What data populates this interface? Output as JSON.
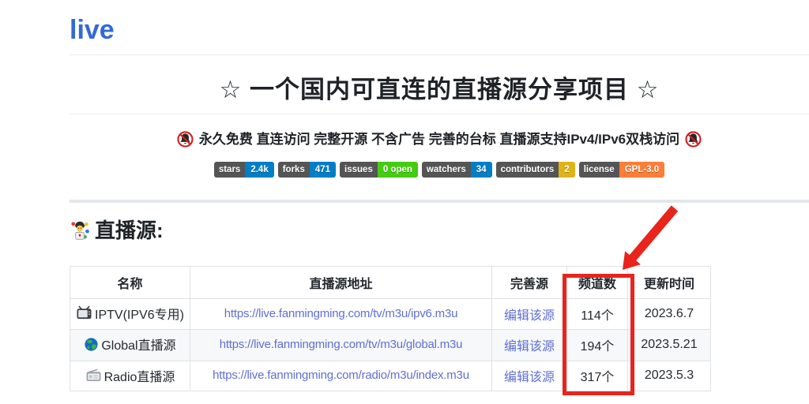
{
  "page": {
    "title": "live",
    "hero_title": "☆ 一个国内可直连的直播源分享项目 ☆",
    "subtitle": "永久免费 直连访问 完整开源 不含广告 完善的台标 直播源支持IPv4/IPv6双栈访问",
    "section_heading": "直播源:"
  },
  "badges": [
    {
      "label": "stars",
      "value": "2.4k",
      "color": "#007ec6"
    },
    {
      "label": "forks",
      "value": "471",
      "color": "#007ec6"
    },
    {
      "label": "issues",
      "value": "0 open",
      "color": "#44cc11"
    },
    {
      "label": "watchers",
      "value": "34",
      "color": "#007ec6"
    },
    {
      "label": "contributors",
      "value": "2",
      "color": "#dfb317"
    },
    {
      "label": "license",
      "value": "GPL-3.0",
      "color": "#fe7d37"
    }
  ],
  "icons": {
    "subtitle_left": "no-bell-icon",
    "subtitle_right": "no-bell-icon",
    "section": "juggler-icon",
    "row0": "tv-icon",
    "row1": "globe-icon",
    "row2": "radio-icon"
  },
  "table": {
    "headers": [
      "名称",
      "直播源地址",
      "完善源",
      "频道数",
      "更新时间"
    ],
    "rows": [
      {
        "name": "IPTV(IPV6专用)",
        "url": "https://live.fanmingming.com/tv/m3u/ipv6.m3u",
        "edit_label": "编辑该源",
        "channels": "114个",
        "updated": "2023.6.7"
      },
      {
        "name": "Global直播源",
        "url": "https://live.fanmingming.com/tv/m3u/global.m3u",
        "edit_label": "编辑该源",
        "channels": "194个",
        "updated": "2023.5.21"
      },
      {
        "name": "Radio直播源",
        "url": "https://live.fanmingming.com/radio/m3u/index.m3u",
        "edit_label": "编辑该源",
        "channels": "317个",
        "updated": "2023.5.3"
      }
    ]
  },
  "annotation": {
    "type": "highlight-box-and-arrow",
    "highlighted_column": "频道数",
    "highlight_color": "#e8241d"
  }
}
